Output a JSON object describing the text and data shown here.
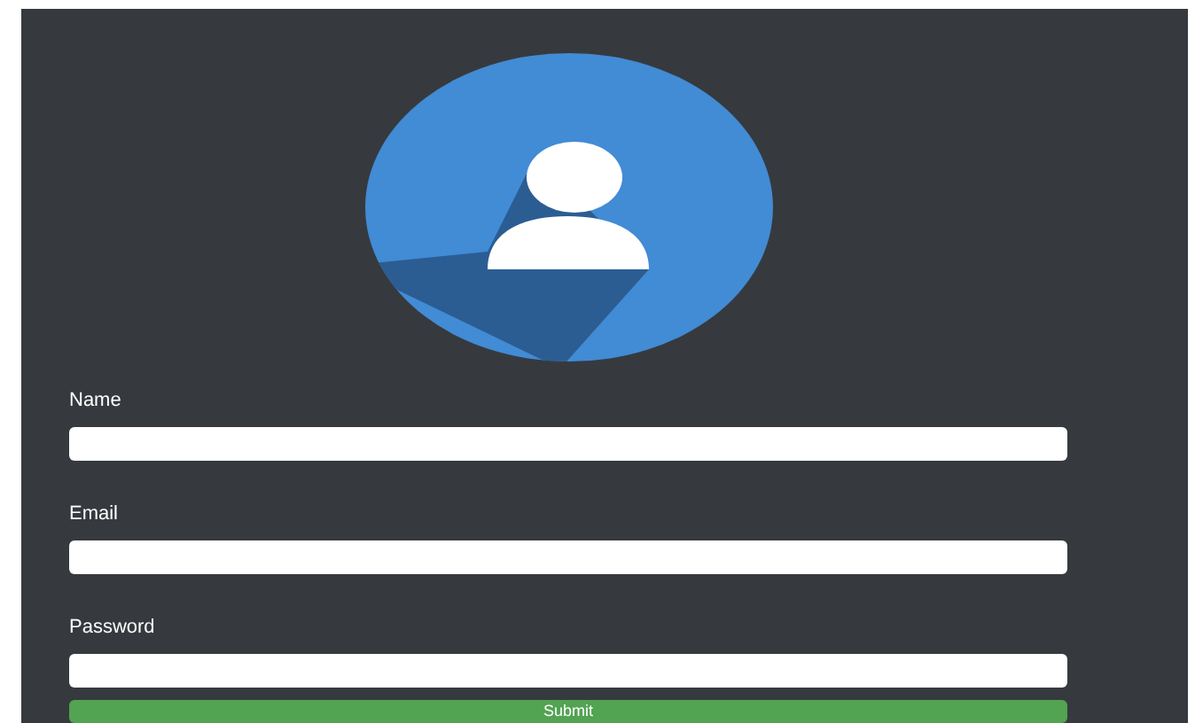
{
  "form": {
    "fields": [
      {
        "label": "Name"
      },
      {
        "label": "Email"
      },
      {
        "label": "Password"
      }
    ],
    "submit": "Submit"
  }
}
